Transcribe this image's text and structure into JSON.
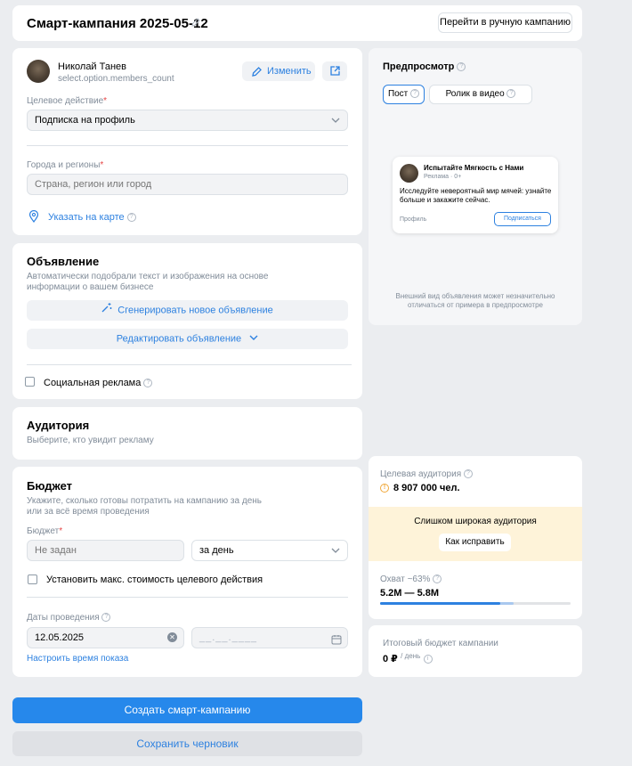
{
  "header": {
    "title": "Смарт-кампания 2025-05-12",
    "manual_button": "Перейти в ручную кампанию"
  },
  "profile": {
    "name": "Николай Танев",
    "subtitle": "select.option.members_count",
    "edit_button": "Изменить"
  },
  "target_action": {
    "label": "Целевое действие",
    "required": "*",
    "value": "Подписка на профиль"
  },
  "regions": {
    "label": "Города и регионы",
    "required": "*",
    "placeholder": "Страна, регион или город",
    "map_link": "Указать на карте"
  },
  "ad": {
    "title": "Объявление",
    "description_line1": "Автоматически подобрали текст и изображения на основе",
    "description_line2": "информации о вашем бизнесе",
    "generate_button": "Сгенерировать новое объявление",
    "edit_button": "Редактировать объявление",
    "social_checkbox": "Социальная реклама"
  },
  "audience": {
    "title": "Аудитория",
    "description": "Выберите, кто увидит рекламу"
  },
  "budget": {
    "title": "Бюджет",
    "description_line1": "Укажите, сколько готовы потратить на кампанию за день",
    "description_line2": "или за всё время проведения",
    "label": "Бюджет",
    "required": "*",
    "placeholder": "Не задан",
    "period_value": "за день",
    "max_cost_checkbox": "Установить макс. стоимость целевого действия",
    "dates_label": "Даты проведения",
    "start_date": "12.05.2025",
    "end_date_placeholder": "__.__.____",
    "schedule_link": "Настроить время показа"
  },
  "actions": {
    "create_button": "Создать смарт-кампанию",
    "draft_button": "Сохранить черновик"
  },
  "preview": {
    "title": "Предпросмотр",
    "tabs": [
      "Пост",
      "Ролик в видео"
    ],
    "post_title": "Испытайте Мягкость с Нами",
    "post_meta": "Реклама · 0+",
    "post_text_line1": "Исследуйте невероятный мир мячей: узнайте",
    "post_text_line2": "больше и закажите сейчас.",
    "post_profile": "Профиль",
    "post_subscribe": "Подписаться",
    "note_line1": "Внешний вид объявления может незначительно",
    "note_line2": "отличаться от примера в предпросмотре"
  },
  "target_audience": {
    "label": "Целевая аудитория",
    "value": "8 907 000 чел.",
    "warning_title": "Слишком широкая аудитория",
    "fix_button": "Как исправить",
    "reach_label": "Охват ~63%",
    "reach_value": "5.2M — 5.8M",
    "reach_fraction": 0.63
  },
  "total_budget": {
    "label": "Итоговый бюджет кампании",
    "value": "0 ₽",
    "per": "/ день"
  },
  "colors": {
    "accent": "#2688eb",
    "link": "#2d81e0",
    "warning_bg": "#fef3d9",
    "warning_icon": "#f0a83a"
  }
}
